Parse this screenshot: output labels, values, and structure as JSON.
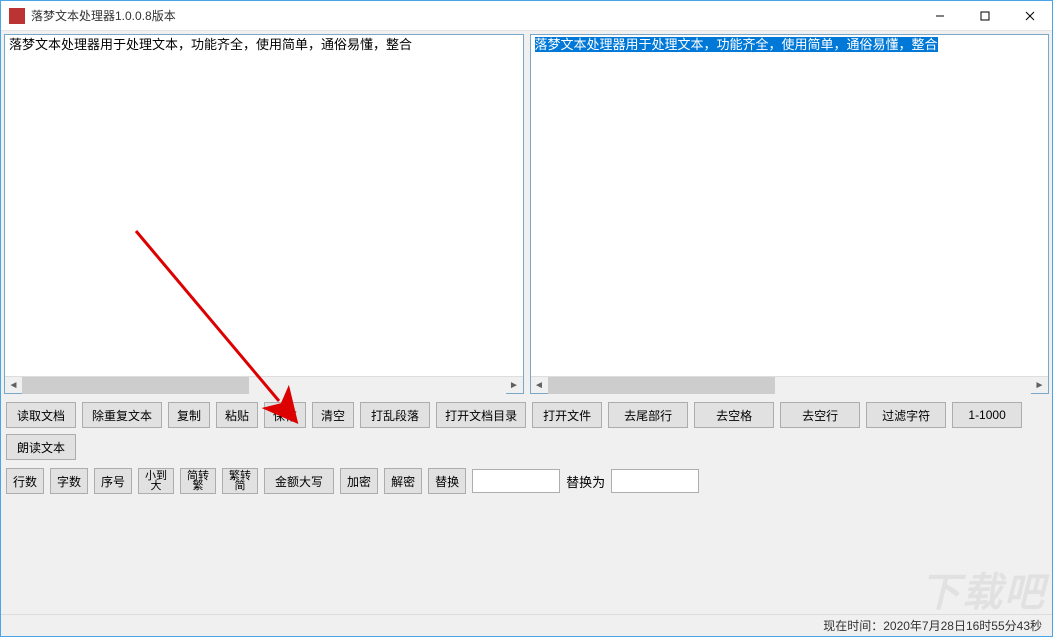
{
  "window": {
    "title": "落梦文本处理器1.0.0.8版本"
  },
  "panes": {
    "left_text": "落梦文本处理器用于处理文本，功能齐全，使用简单，通俗易懂，整合",
    "right_text": "落梦文本处理器用于处理文本，功能齐全，使用简单，通俗易懂，整合"
  },
  "toolbar1": {
    "read_doc": "读取文档",
    "dedup": "除重复文本",
    "copy": "复制",
    "paste": "粘贴",
    "save": "保存",
    "clear": "清空",
    "shuffle_para": "打乱段落",
    "open_dir": "打开文档目录",
    "open_file": "打开文件",
    "trim_tail": "去尾部行",
    "trim_space": "去空格",
    "trim_empty": "去空行",
    "filter_chars": "过滤字符",
    "range": "1-1000",
    "read_aloud": "朗读文本"
  },
  "toolbar2": {
    "lines": "行数",
    "chars": "字数",
    "seq": "序号",
    "sort_asc": "小到\n大",
    "s2t": "简转\n繁",
    "t2s": "繁转\n简",
    "money": "金额大写",
    "encrypt": "加密",
    "decrypt": "解密",
    "replace": "替换",
    "replace_to_label": "替换为",
    "find_value": "",
    "replace_value": ""
  },
  "status": {
    "time_label": "现在时间：2020年7月28日16时55分43秒"
  },
  "watermark": "下载吧"
}
